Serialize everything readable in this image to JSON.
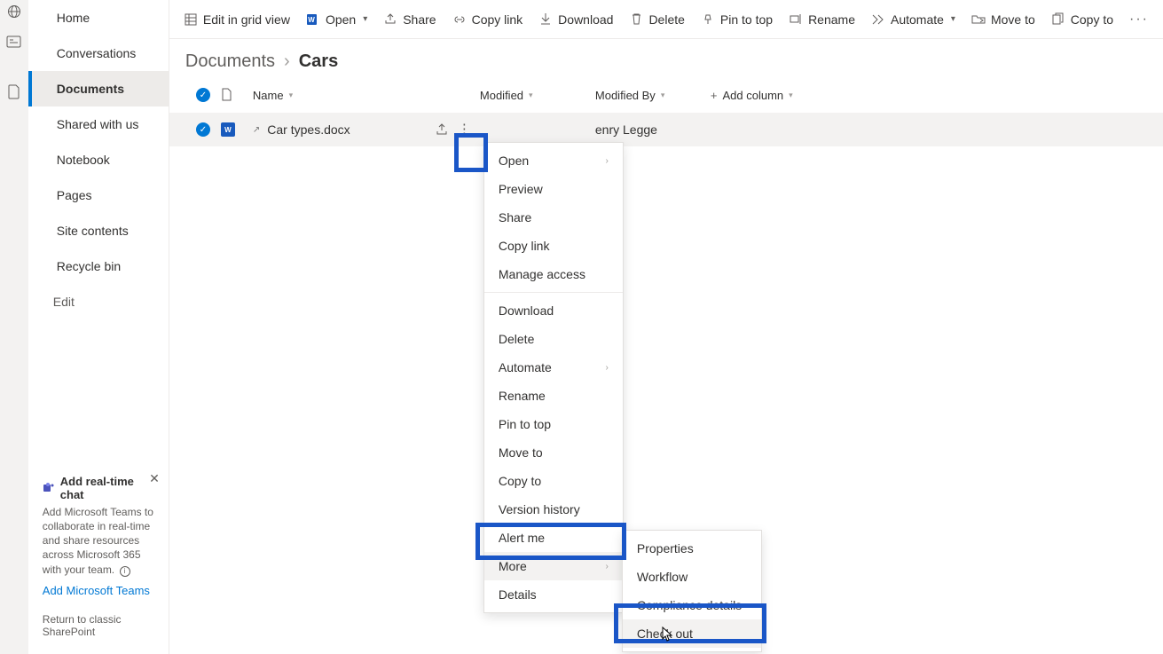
{
  "rail_icons": [
    "globe-icon",
    "news-icon",
    "file-icon"
  ],
  "sidebar": {
    "items": [
      {
        "label": "Home"
      },
      {
        "label": "Conversations"
      },
      {
        "label": "Documents",
        "selected": true
      },
      {
        "label": "Shared with us"
      },
      {
        "label": "Notebook"
      },
      {
        "label": "Pages"
      },
      {
        "label": "Site contents"
      },
      {
        "label": "Recycle bin"
      }
    ],
    "edit_label": "Edit",
    "teams": {
      "title": "Add real-time chat",
      "desc": "Add Microsoft Teams to collaborate in real-time and share resources across Microsoft 365 with your team.",
      "link": "Add Microsoft Teams"
    },
    "classic_link": "Return to classic SharePoint"
  },
  "toolbar": {
    "edit_grid": "Edit in grid view",
    "open": "Open",
    "share": "Share",
    "copy_link": "Copy link",
    "download": "Download",
    "delete": "Delete",
    "pin": "Pin to top",
    "rename": "Rename",
    "automate": "Automate",
    "move": "Move to",
    "copy": "Copy to"
  },
  "breadcrumb": {
    "root": "Documents",
    "current": "Cars"
  },
  "columns": {
    "name": "Name",
    "modified": "Modified",
    "modified_by": "Modified By",
    "add": "Add column"
  },
  "row": {
    "filename": "Car types.docx",
    "modified_by": "enry Legge"
  },
  "context_menu": {
    "items": [
      {
        "label": "Open",
        "sub": true
      },
      {
        "label": "Preview"
      },
      {
        "label": "Share"
      },
      {
        "label": "Copy link"
      },
      {
        "label": "Manage access"
      },
      {
        "sep": true
      },
      {
        "label": "Download"
      },
      {
        "label": "Delete"
      },
      {
        "label": "Automate",
        "sub": true
      },
      {
        "label": "Rename"
      },
      {
        "label": "Pin to top"
      },
      {
        "label": "Move to"
      },
      {
        "label": "Copy to"
      },
      {
        "label": "Version history"
      },
      {
        "label": "Alert me"
      },
      {
        "label": "More",
        "sub": true,
        "hover": true
      },
      {
        "label": "Details"
      }
    ]
  },
  "submenu": {
    "items": [
      {
        "label": "Properties"
      },
      {
        "label": "Workflow"
      },
      {
        "label": "Compliance details"
      },
      {
        "label": "Check out",
        "hover": true
      }
    ]
  }
}
